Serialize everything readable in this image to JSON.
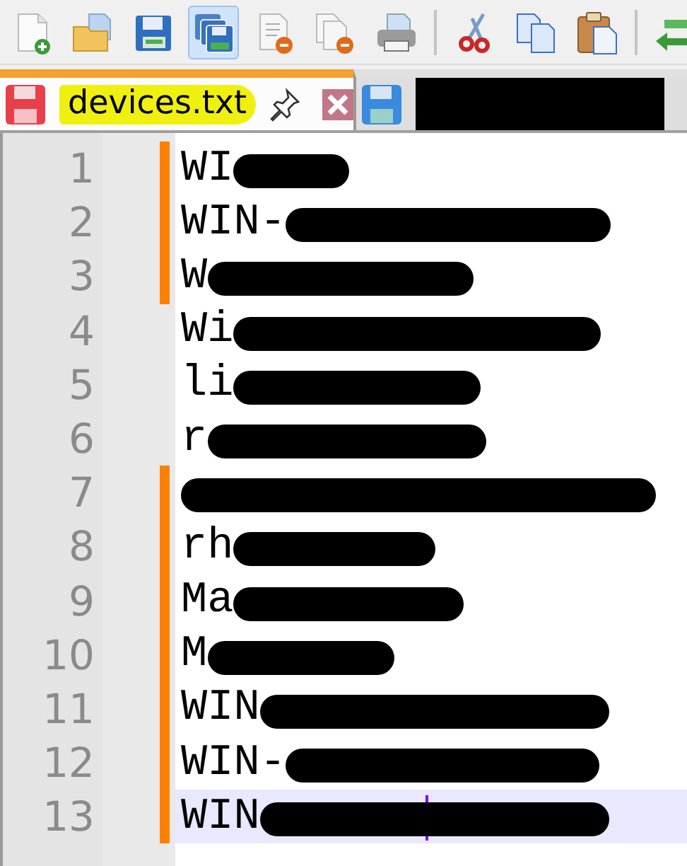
{
  "toolbar": {
    "buttons": [
      {
        "kind": "new",
        "pressed": false
      },
      {
        "kind": "open",
        "pressed": false
      },
      {
        "kind": "save",
        "pressed": false
      },
      {
        "kind": "save-all",
        "pressed": true
      },
      {
        "kind": "close",
        "pressed": false
      },
      {
        "kind": "close-all",
        "pressed": false
      },
      {
        "kind": "print",
        "pressed": false
      },
      {
        "kind": "separator"
      },
      {
        "kind": "cut",
        "pressed": false
      },
      {
        "kind": "copy",
        "pressed": false
      },
      {
        "kind": "paste",
        "pressed": false
      },
      {
        "kind": "separator"
      },
      {
        "kind": "arrows",
        "pressed": false
      }
    ]
  },
  "tabs": [
    {
      "label": "devices.txt",
      "selected": true,
      "highlighted": true,
      "redacted": false
    },
    {
      "selected": false,
      "highlighted": false,
      "redacted": true
    }
  ],
  "lines": [
    {
      "number": "1",
      "text": "WI",
      "modified": true,
      "redacted": true,
      "current": false
    },
    {
      "number": "2",
      "text": "WIN-",
      "modified": true,
      "redacted": true,
      "current": false
    },
    {
      "number": "3",
      "text": "W",
      "modified": true,
      "redacted": true,
      "current": false
    },
    {
      "number": "4",
      "text": "Wi",
      "modified": false,
      "redacted": true,
      "current": false
    },
    {
      "number": "5",
      "text": "li",
      "modified": false,
      "redacted": true,
      "current": false
    },
    {
      "number": "6",
      "text": "r",
      "modified": false,
      "redacted": true,
      "current": false
    },
    {
      "number": "7",
      "modified": true,
      "redacted": true,
      "current": false
    },
    {
      "number": "8",
      "text": "rh",
      "modified": true,
      "redacted": true,
      "current": false
    },
    {
      "number": "9",
      "text": "Ma",
      "modified": true,
      "redacted": true,
      "current": false
    },
    {
      "number": "10",
      "text": "M",
      "modified": true,
      "redacted": true,
      "current": false
    },
    {
      "number": "11",
      "text": "WIN",
      "modified": true,
      "redacted": true,
      "current": false
    },
    {
      "number": "12",
      "text": "WIN-",
      "modified": true,
      "redacted": true,
      "current": false
    },
    {
      "number": "13",
      "text": "WIN",
      "modified": true,
      "redacted": true,
      "current": true
    }
  ]
}
